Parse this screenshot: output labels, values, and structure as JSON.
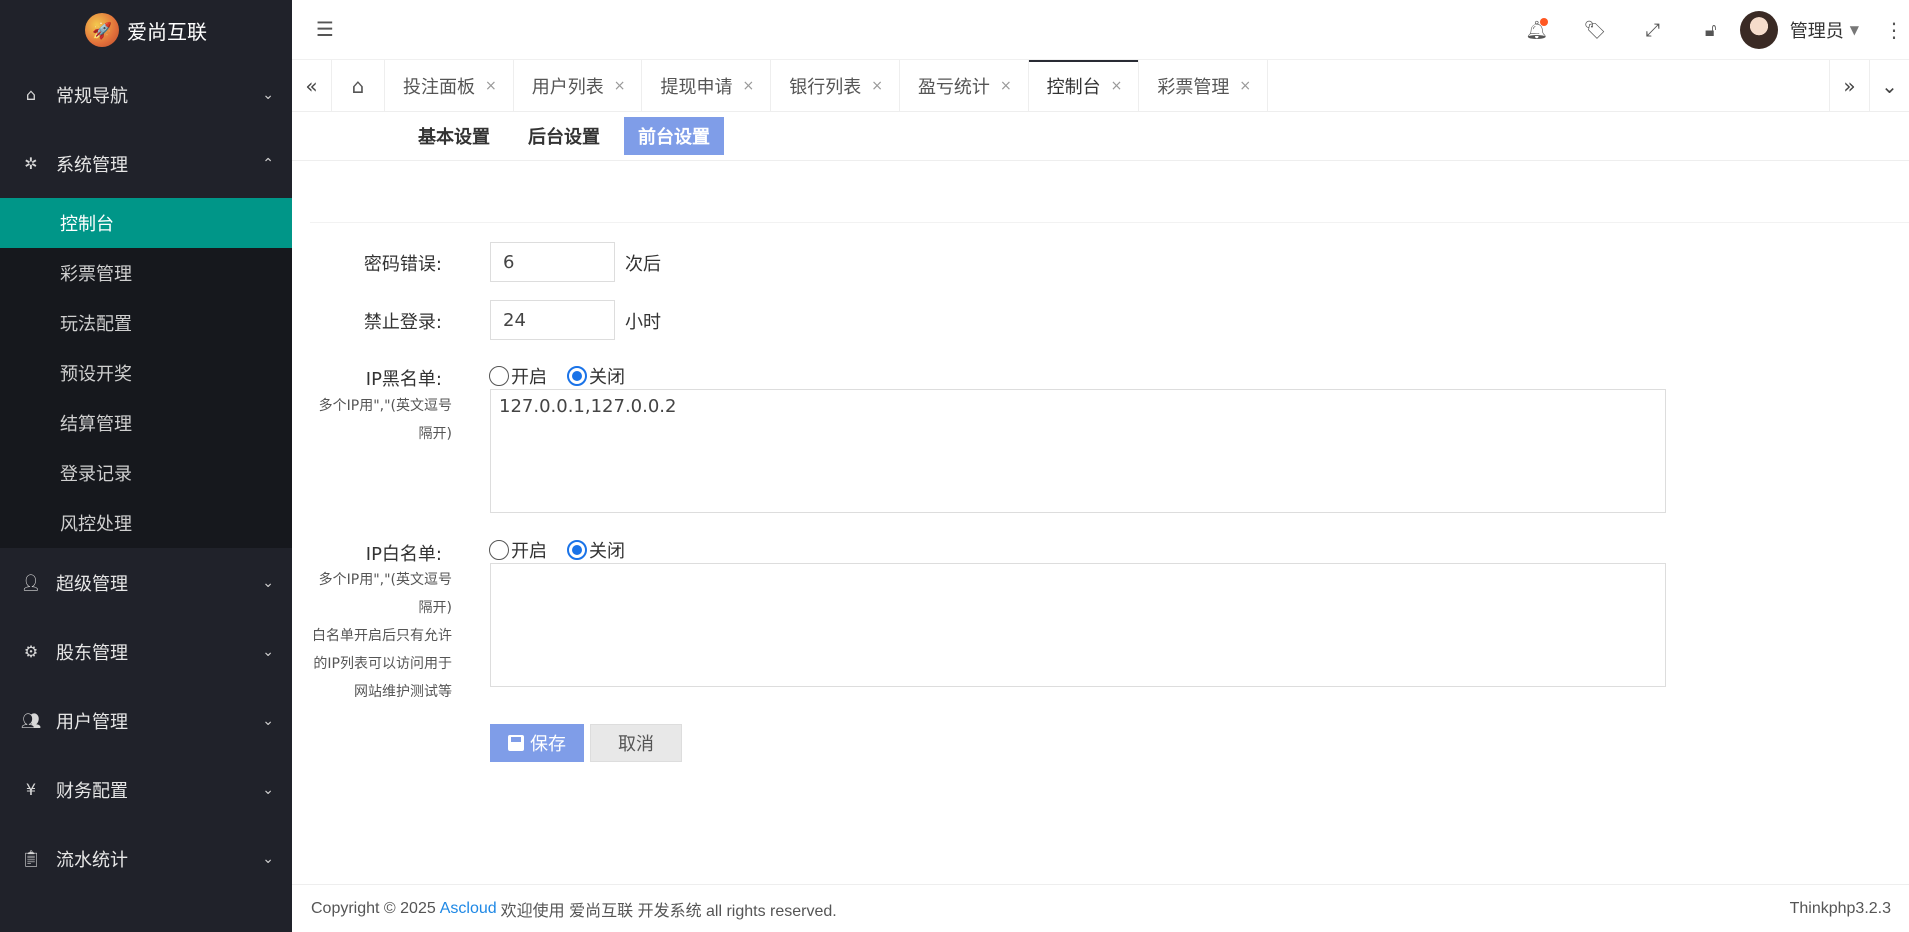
{
  "brand": {
    "name": "爱尚互联"
  },
  "sidebar": {
    "groups": [
      {
        "label": "常规导航",
        "icon": "home-icon",
        "expanded": false
      },
      {
        "label": "系统管理",
        "icon": "gear-icon",
        "expanded": true,
        "items": [
          "控制台",
          "彩票管理",
          "玩法配置",
          "预设开奖",
          "结算管理",
          "登录记录",
          "风控处理"
        ],
        "active_item": "控制台"
      },
      {
        "label": "超级管理",
        "icon": "user-icon",
        "expanded": false
      },
      {
        "label": "股东管理",
        "icon": "settings-icon",
        "expanded": false
      },
      {
        "label": "用户管理",
        "icon": "users-icon",
        "expanded": false
      },
      {
        "label": "财务配置",
        "icon": "yen-icon",
        "expanded": false
      },
      {
        "label": "流水统计",
        "icon": "clipboard-icon",
        "expanded": false
      }
    ]
  },
  "header": {
    "user_name": "管理员"
  },
  "tabs": [
    {
      "label": "投注面板"
    },
    {
      "label": "用户列表"
    },
    {
      "label": "提现申请"
    },
    {
      "label": "银行列表"
    },
    {
      "label": "盈亏统计"
    },
    {
      "label": "控制台",
      "active": true
    },
    {
      "label": "彩票管理"
    }
  ],
  "subtabs": [
    {
      "label": "基本设置"
    },
    {
      "label": "后台设置"
    },
    {
      "label": "前台设置",
      "active": true
    }
  ],
  "form": {
    "password_error": {
      "label": "密码错误:",
      "value": "6",
      "unit": "次后"
    },
    "ban_login": {
      "label": "禁止登录:",
      "value": "24",
      "unit": "小时"
    },
    "ip_blacklist": {
      "label": "IP黑名单:",
      "note": "多个IP用\",\"(英文逗号隔开)",
      "option_on": "开启",
      "option_off": "关闭",
      "selected": "关闭",
      "value": "127.0.0.1,127.0.0.2"
    },
    "ip_whitelist": {
      "label": "IP白名单:",
      "note": "多个IP用\",\"(英文逗号隔开)",
      "note2": "白名单开启后只有允许的IP列表可以访问用于网站维护测试等",
      "option_on": "开启",
      "option_off": "关闭",
      "selected": "关闭",
      "value": ""
    },
    "save_label": "保存",
    "cancel_label": "取消"
  },
  "footer": {
    "copyright": "Copyright © 2025",
    "link": "Ascloud",
    "text": "欢迎使用 爱尚互联 开发系统 all rights reserved.",
    "version": "Thinkphp3.2.3"
  },
  "colors": {
    "sidebar_bg": "#20222a",
    "active_green": "#009688",
    "accent_blue": "#7f9de8"
  }
}
